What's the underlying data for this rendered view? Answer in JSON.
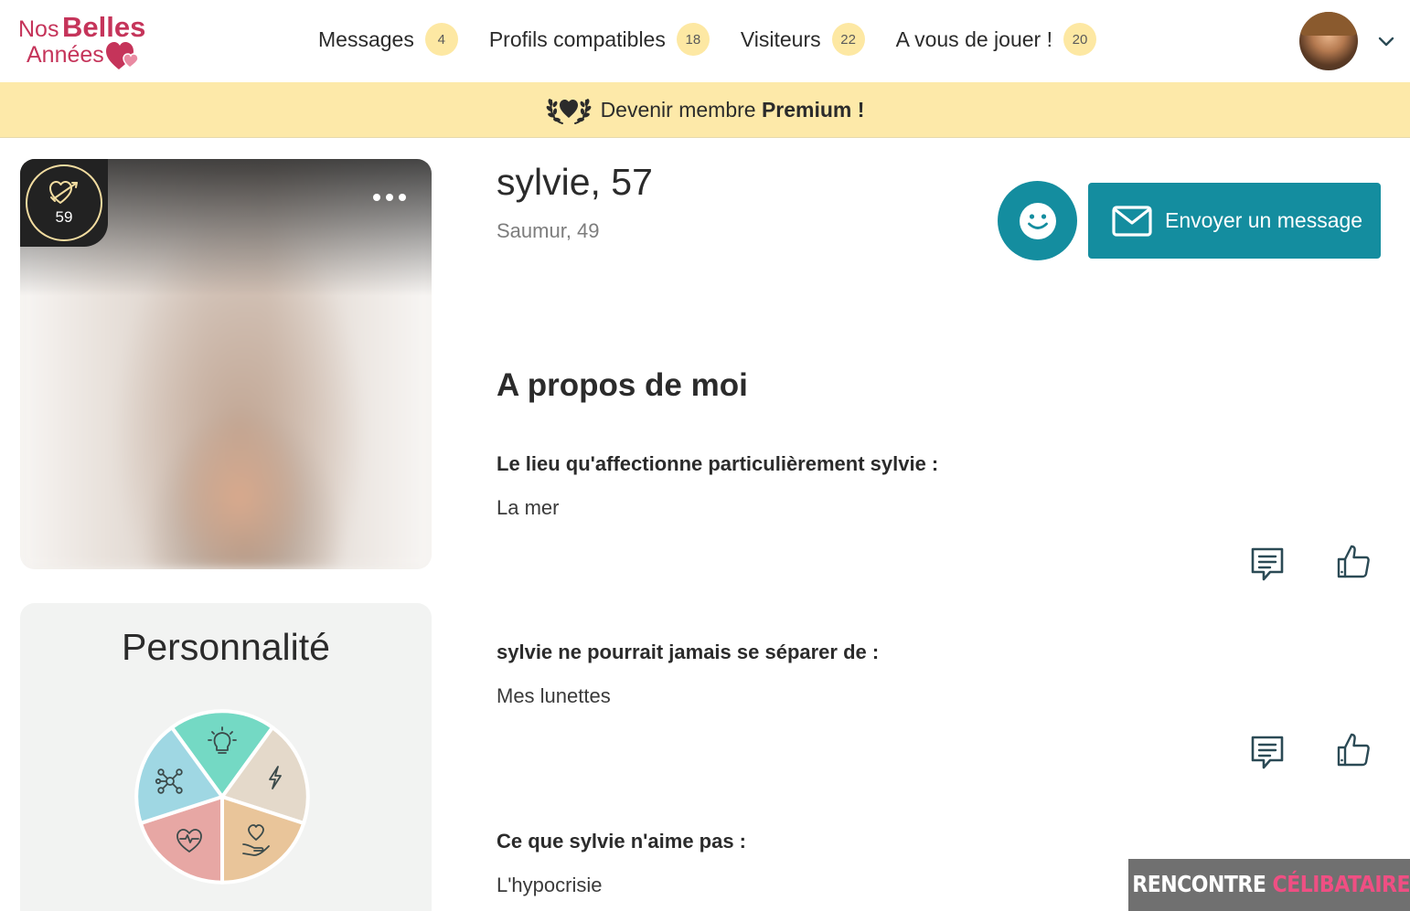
{
  "logo": {
    "line1_a": "Nos",
    "line1_b": "Belles",
    "line2": "Années"
  },
  "nav": [
    {
      "label": "Messages",
      "count": "4"
    },
    {
      "label": "Profils compatibles",
      "count": "18"
    },
    {
      "label": "Visiteurs",
      "count": "22"
    },
    {
      "label": "A vous de jouer !",
      "count": "20"
    }
  ],
  "premium_banner": {
    "text_prefix": "Devenir membre",
    "text_bold": "Premium !"
  },
  "photo_card": {
    "compatibility_score": "59"
  },
  "personality": {
    "title": "Personnalité",
    "segments": [
      "lightbulb-icon",
      "lightning-icon",
      "hand-heart-icon",
      "heartbeat-icon",
      "network-icon"
    ]
  },
  "profile": {
    "name_age": "sylvie, 57",
    "location": "Saumur, 49",
    "message_button": "Envoyer un message"
  },
  "about": {
    "title": "A propos de moi",
    "items": [
      {
        "question": "Le lieu qu'affectionne particulièrement sylvie :",
        "answer": "La mer"
      },
      {
        "question": "sylvie ne pourrait jamais se séparer de :",
        "answer": "Mes lunettes"
      },
      {
        "question": "Ce que sylvie n'aime pas :",
        "answer": "L'hypocrisie"
      }
    ]
  },
  "watermark": {
    "part1": "RENCONTRE",
    "part2": "CÉLIBATAIRE"
  },
  "colors": {
    "brand": "#c5345a",
    "accent": "#148d9f",
    "premium_bg": "#fde9a9",
    "badge_bg": "#fde8a3"
  }
}
